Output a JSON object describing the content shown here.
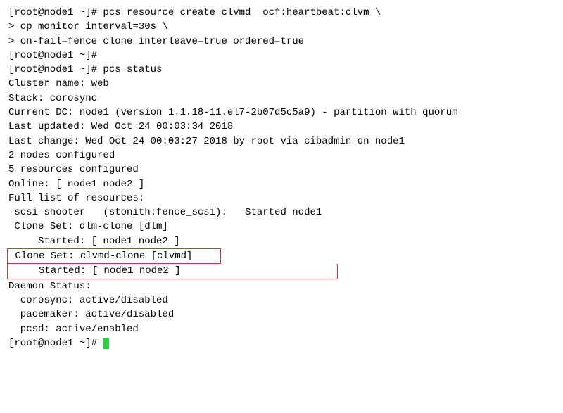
{
  "lines": {
    "l1": "[root@node1 ~]# pcs resource create clvmd  ocf:heartbeat:clvm \\",
    "l2": "> op monitor interval=30s \\",
    "l3": "> on-fail=fence clone interleave=true ordered=true",
    "l4": "[root@node1 ~]#",
    "l5": "[root@node1 ~]# pcs status",
    "l6": "Cluster name: web",
    "l7": "Stack: corosync",
    "l8": "Current DC: node1 (version 1.1.18-11.el7-2b07d5c5a9) - partition with quorum",
    "l9": "Last updated: Wed Oct 24 00:03:34 2018",
    "l10": "Last change: Wed Oct 24 00:03:27 2018 by root via cibadmin on node1",
    "l11": "",
    "l12": "2 nodes configured",
    "l13": "5 resources configured",
    "l14": "",
    "l15": "Online: [ node1 node2 ]",
    "l16": "",
    "l17": "Full list of resources:",
    "l18": "",
    "l19": " scsi-shooter   (stonith:fence_scsi):   Started node1",
    "l20": " Clone Set: dlm-clone [dlm]",
    "l21": "     Started: [ node1 node2 ]",
    "l22": " Clone Set: clvmd-clone [clvmd]",
    "l23": "     Started: [ node1 node2 ]",
    "l24": "",
    "l25": "Daemon Status:",
    "l26": "  corosync: active/disabled",
    "l27": "  pacemaker: active/disabled",
    "l28": "  pcsd: active/enabled",
    "l29": "[root@node1 ~]# "
  }
}
